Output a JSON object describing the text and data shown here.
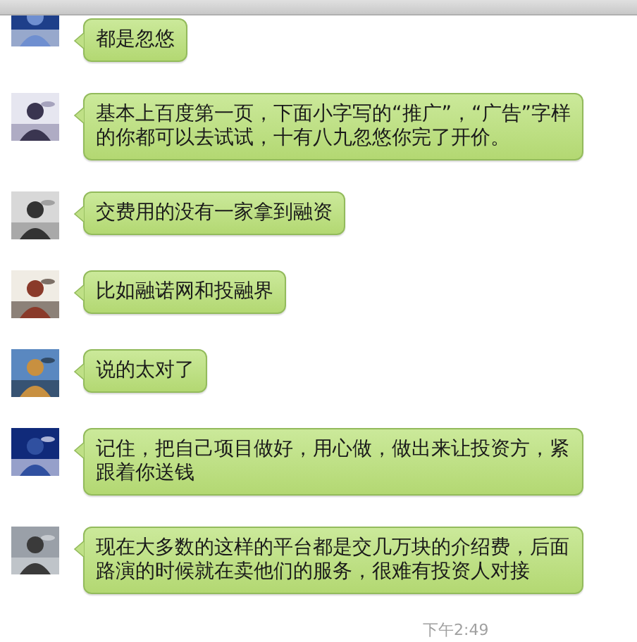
{
  "messages": [
    {
      "text": "都是忽悠"
    },
    {
      "text": "基本上百度第一页，下面小字写的“推广”，“广告”字样的你都可以去试试，十有八九忽悠你完了开价。"
    },
    {
      "text": "交费用的没有一家拿到融资"
    },
    {
      "text": "比如融诺网和投融界"
    },
    {
      "text": "说的太对了"
    },
    {
      "text": "记住，把自己项目做好，用心做，做出来让投资方，紧跟着你送钱"
    },
    {
      "text": "现在大多数的这样的平台都是交几万块的介绍费，后面路演的时候就在卖他们的服务，很难有投资人对接"
    }
  ],
  "timestamp": "下午2:49"
}
